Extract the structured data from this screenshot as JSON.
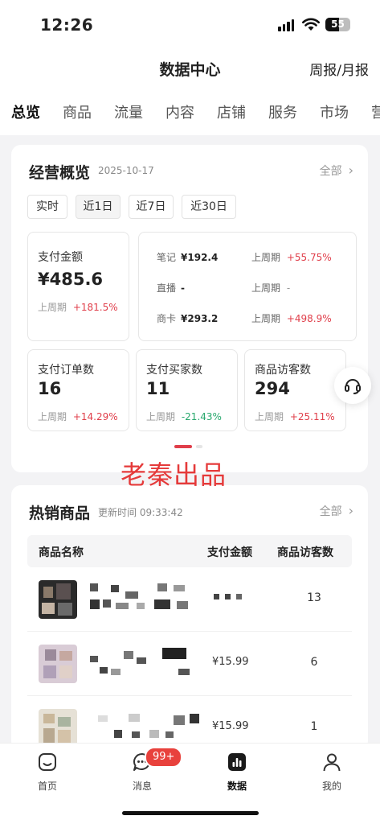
{
  "status": {
    "time": "12:26",
    "battery": "55"
  },
  "nav": {
    "title": "数据中心",
    "right": "周报/月报"
  },
  "tabs": [
    "总览",
    "商品",
    "流量",
    "内容",
    "店铺",
    "服务",
    "市场",
    "营"
  ],
  "overview": {
    "title": "经营概览",
    "date": "2025-10-17",
    "all": "全部",
    "ranges": [
      "实时",
      "近1日",
      "近7日",
      "近30日"
    ],
    "pay_amount": {
      "label": "支付金额",
      "value": "¥485.6",
      "compare_label": "上周期",
      "compare": "+181.5%"
    },
    "breakdown": [
      {
        "label": "笔记",
        "value": "¥192.4",
        "compare_label": "上周期",
        "compare": "+55.75%"
      },
      {
        "label": "直播",
        "value": "-",
        "compare_label": "上周期",
        "compare": "-"
      },
      {
        "label": "商卡",
        "value": "¥293.2",
        "compare_label": "上周期",
        "compare": "+498.9%"
      }
    ],
    "metrics": [
      {
        "label": "支付订单数",
        "value": "16",
        "compare_label": "上周期",
        "compare": "+14.29%",
        "trend": "up"
      },
      {
        "label": "支付买家数",
        "value": "11",
        "compare_label": "上周期",
        "compare": "-21.43%",
        "trend": "down"
      },
      {
        "label": "商品访客数",
        "value": "294",
        "compare_label": "上周期",
        "compare": "+25.11%",
        "trend": "up"
      }
    ]
  },
  "watermark": "老秦出品",
  "hot": {
    "title": "热销商品",
    "updated": "更新时间 09:33:42",
    "all": "全部",
    "columns": [
      "商品名称",
      "支付金额",
      "商品访客数"
    ],
    "rows": [
      {
        "pay": "",
        "visits": "13"
      },
      {
        "pay": "¥15.99",
        "visits": "6"
      },
      {
        "pay": "¥15.99",
        "visits": "1"
      }
    ]
  },
  "tabbar": {
    "items": [
      "首页",
      "消息",
      "数据",
      "我的"
    ],
    "badge": "99+"
  },
  "colors": {
    "accent": "#e03e4a",
    "positive": "#e03e4a",
    "negative": "#28a86d"
  }
}
